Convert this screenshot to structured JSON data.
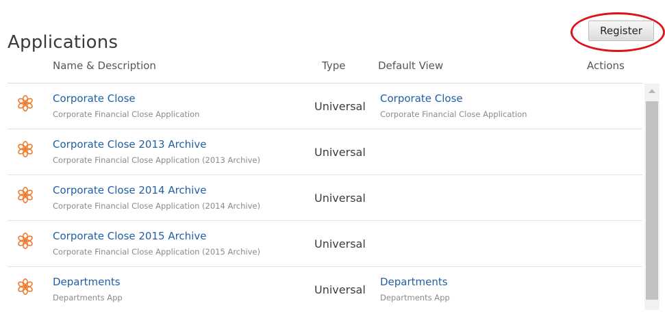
{
  "page": {
    "title": "Applications"
  },
  "toolbar": {
    "register_label": "Register"
  },
  "table": {
    "headers": {
      "name_description": "Name & Description",
      "type": "Type",
      "default_view": "Default View",
      "actions": "Actions"
    },
    "rows": [
      {
        "name": "Corporate Close",
        "description": "Corporate Financial Close Application",
        "type": "Universal",
        "view_name": "Corporate Close",
        "view_description": "Corporate Financial Close Application"
      },
      {
        "name": "Corporate Close 2013 Archive",
        "description": "Corporate Financial Close Application (2013 Archive)",
        "type": "Universal",
        "view_name": "",
        "view_description": ""
      },
      {
        "name": "Corporate Close 2014 Archive",
        "description": "Corporate Financial Close Application (2014 Archive)",
        "type": "Universal",
        "view_name": "",
        "view_description": ""
      },
      {
        "name": "Corporate Close 2015 Archive",
        "description": "Corporate Financial Close Application (2015 Archive)",
        "type": "Universal",
        "view_name": "",
        "view_description": ""
      },
      {
        "name": "Departments",
        "description": "Departments App",
        "type": "Universal",
        "view_name": "Departments",
        "view_description": "Departments App"
      }
    ]
  },
  "icons": {
    "application": "application-flower-icon"
  },
  "colors": {
    "link": "#1f5fa6",
    "icon": "#f07a2c",
    "highlight_ring": "#e0111b"
  }
}
